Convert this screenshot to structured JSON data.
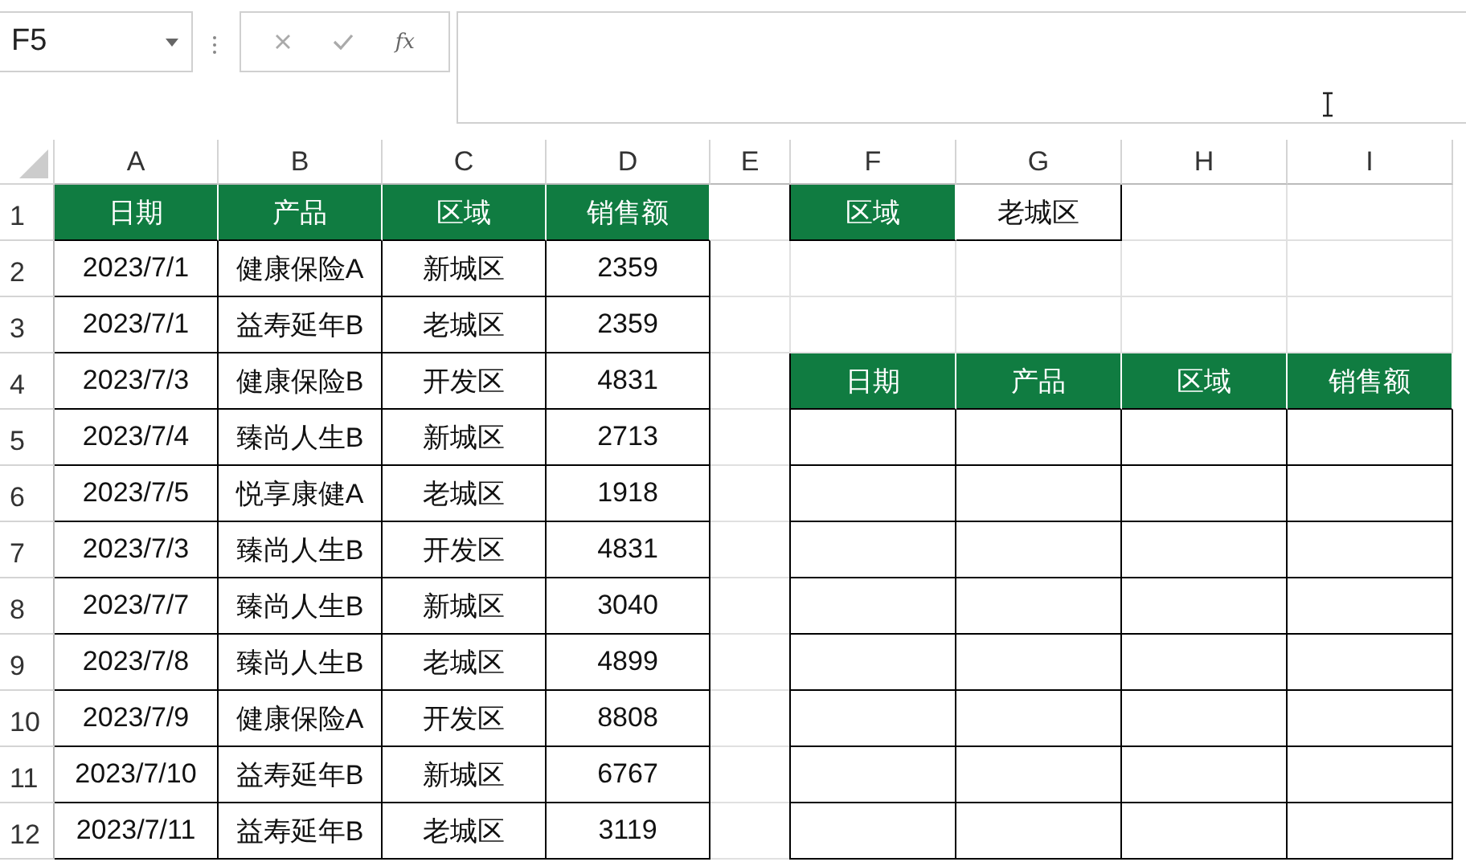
{
  "name_box": {
    "value": "F5"
  },
  "formula_bar": {
    "function_label": "fx"
  },
  "columns": [
    "A",
    "B",
    "C",
    "D",
    "E",
    "F",
    "G",
    "H",
    "I"
  ],
  "rows": [
    {
      "number": "1",
      "cells": [
        {
          "kind": "header",
          "text": "日期"
        },
        {
          "kind": "header",
          "text": "产品"
        },
        {
          "kind": "header",
          "text": "区域"
        },
        {
          "kind": "header",
          "text": "销售额"
        },
        {
          "kind": "blank"
        },
        {
          "kind": "header",
          "text": "区域"
        },
        {
          "kind": "boxed",
          "text": "老城区"
        },
        {
          "kind": "blank"
        },
        {
          "kind": "blank"
        }
      ]
    },
    {
      "number": "2",
      "cells": [
        {
          "kind": "boxed",
          "text": "2023/7/1"
        },
        {
          "kind": "boxed",
          "text": "健康保险A"
        },
        {
          "kind": "boxed",
          "text": "新城区"
        },
        {
          "kind": "boxed",
          "text": "2359"
        },
        {
          "kind": "blank"
        },
        {
          "kind": "blank"
        },
        {
          "kind": "blank"
        },
        {
          "kind": "blank"
        },
        {
          "kind": "blank"
        }
      ]
    },
    {
      "number": "3",
      "cells": [
        {
          "kind": "boxed",
          "text": "2023/7/1"
        },
        {
          "kind": "boxed",
          "text": "益寿延年B"
        },
        {
          "kind": "boxed",
          "text": "老城区"
        },
        {
          "kind": "boxed",
          "text": "2359"
        },
        {
          "kind": "blank"
        },
        {
          "kind": "blank"
        },
        {
          "kind": "blank"
        },
        {
          "kind": "blank"
        },
        {
          "kind": "blank"
        }
      ]
    },
    {
      "number": "4",
      "cells": [
        {
          "kind": "boxed",
          "text": "2023/7/3"
        },
        {
          "kind": "boxed",
          "text": "健康保险B"
        },
        {
          "kind": "boxed",
          "text": "开发区"
        },
        {
          "kind": "boxed",
          "text": "4831"
        },
        {
          "kind": "blank"
        },
        {
          "kind": "header",
          "text": "日期"
        },
        {
          "kind": "header",
          "text": "产品"
        },
        {
          "kind": "header",
          "text": "区域"
        },
        {
          "kind": "header",
          "text": "销售额"
        }
      ]
    },
    {
      "number": "5",
      "cells": [
        {
          "kind": "boxed",
          "text": "2023/7/4"
        },
        {
          "kind": "boxed",
          "text": "臻尚人生B"
        },
        {
          "kind": "boxed",
          "text": "新城区"
        },
        {
          "kind": "boxed",
          "text": "2713"
        },
        {
          "kind": "blank"
        },
        {
          "kind": "boxed"
        },
        {
          "kind": "boxed"
        },
        {
          "kind": "boxed"
        },
        {
          "kind": "boxed"
        }
      ]
    },
    {
      "number": "6",
      "cells": [
        {
          "kind": "boxed",
          "text": "2023/7/5"
        },
        {
          "kind": "boxed",
          "text": "悦享康健A"
        },
        {
          "kind": "boxed",
          "text": "老城区"
        },
        {
          "kind": "boxed",
          "text": "1918"
        },
        {
          "kind": "blank"
        },
        {
          "kind": "boxed"
        },
        {
          "kind": "boxed"
        },
        {
          "kind": "boxed"
        },
        {
          "kind": "boxed"
        }
      ]
    },
    {
      "number": "7",
      "cells": [
        {
          "kind": "boxed",
          "text": "2023/7/3"
        },
        {
          "kind": "boxed",
          "text": "臻尚人生B"
        },
        {
          "kind": "boxed",
          "text": "开发区"
        },
        {
          "kind": "boxed",
          "text": "4831"
        },
        {
          "kind": "blank"
        },
        {
          "kind": "boxed"
        },
        {
          "kind": "boxed"
        },
        {
          "kind": "boxed"
        },
        {
          "kind": "boxed"
        }
      ]
    },
    {
      "number": "8",
      "cells": [
        {
          "kind": "boxed",
          "text": "2023/7/7"
        },
        {
          "kind": "boxed",
          "text": "臻尚人生B"
        },
        {
          "kind": "boxed",
          "text": "新城区"
        },
        {
          "kind": "boxed",
          "text": "3040"
        },
        {
          "kind": "blank"
        },
        {
          "kind": "boxed"
        },
        {
          "kind": "boxed"
        },
        {
          "kind": "boxed"
        },
        {
          "kind": "boxed"
        }
      ]
    },
    {
      "number": "9",
      "cells": [
        {
          "kind": "boxed",
          "text": "2023/7/8"
        },
        {
          "kind": "boxed",
          "text": "臻尚人生B"
        },
        {
          "kind": "boxed",
          "text": "老城区"
        },
        {
          "kind": "boxed",
          "text": "4899"
        },
        {
          "kind": "blank"
        },
        {
          "kind": "boxed"
        },
        {
          "kind": "boxed"
        },
        {
          "kind": "boxed"
        },
        {
          "kind": "boxed"
        }
      ]
    },
    {
      "number": "10",
      "cells": [
        {
          "kind": "boxed",
          "text": "2023/7/9"
        },
        {
          "kind": "boxed",
          "text": "健康保险A"
        },
        {
          "kind": "boxed",
          "text": "开发区"
        },
        {
          "kind": "boxed",
          "text": "8808"
        },
        {
          "kind": "blank"
        },
        {
          "kind": "boxed"
        },
        {
          "kind": "boxed"
        },
        {
          "kind": "boxed"
        },
        {
          "kind": "boxed"
        }
      ]
    },
    {
      "number": "11",
      "cells": [
        {
          "kind": "boxed",
          "text": "2023/7/10"
        },
        {
          "kind": "boxed",
          "text": "益寿延年B"
        },
        {
          "kind": "boxed",
          "text": "新城区"
        },
        {
          "kind": "boxed",
          "text": "6767"
        },
        {
          "kind": "blank"
        },
        {
          "kind": "boxed"
        },
        {
          "kind": "boxed"
        },
        {
          "kind": "boxed"
        },
        {
          "kind": "boxed"
        }
      ]
    },
    {
      "number": "12",
      "cells": [
        {
          "kind": "boxed",
          "text": "2023/7/11"
        },
        {
          "kind": "boxed",
          "text": "益寿延年B"
        },
        {
          "kind": "boxed",
          "text": "老城区"
        },
        {
          "kind": "boxed",
          "text": "3119"
        },
        {
          "kind": "blank"
        },
        {
          "kind": "boxed"
        },
        {
          "kind": "boxed"
        },
        {
          "kind": "boxed"
        },
        {
          "kind": "boxed"
        }
      ]
    }
  ]
}
